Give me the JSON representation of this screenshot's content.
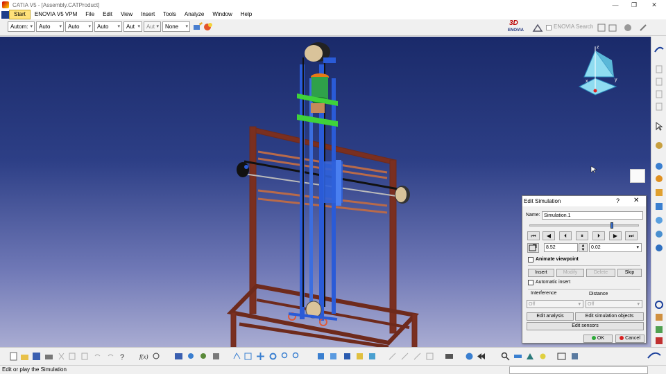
{
  "window": {
    "title": "CATIA V5 - [Assembly.CATProduct]",
    "controls": [
      "—",
      "❐",
      "✕"
    ]
  },
  "menu": [
    "Start",
    "ENOVIA V5 VPM",
    "File",
    "Edit",
    "View",
    "Insert",
    "Tools",
    "Analyze",
    "Window",
    "Help"
  ],
  "toolbar": {
    "combos": [
      "Autom:",
      "Auto",
      "Auto",
      "Auto",
      "Aut",
      "Aut",
      "None"
    ],
    "enovia_logo_top": "3D",
    "enovia_logo_bottom": "ENOVIA",
    "enovia_search": "ENOVIA Search"
  },
  "compass": {
    "axis_z": "z",
    "axis_x": "x",
    "axis_y": "y"
  },
  "dialog": {
    "title": "Edit Simulation",
    "help": "?",
    "close": "✕",
    "name_label": "Name:",
    "name_value": "Simulation.1",
    "slider_position": 0.75,
    "step_value": "8.52",
    "increment_value": "0.02",
    "animate_viewpoint": "Animate viewpoint",
    "insert": "Insert",
    "modify": "Modify",
    "delete": "Delete",
    "skip": "Skip",
    "automatic_insert": "Automatic insert",
    "interference_label": "Interference",
    "interference_value": "Off",
    "distance_label": "Distance",
    "distance_value": "Off",
    "edit_analysis": "Edit analysis",
    "edit_sim_objects": "Edit simulation objects",
    "edit_sensors": "Edit sensors",
    "ok": "OK",
    "cancel": "Cancel"
  },
  "status": {
    "message": "Edit or play the Simulation"
  },
  "colors": {
    "frame": "#7a2f20",
    "blue_part": "#2a5bd7",
    "green_part": "#3fd23a"
  }
}
